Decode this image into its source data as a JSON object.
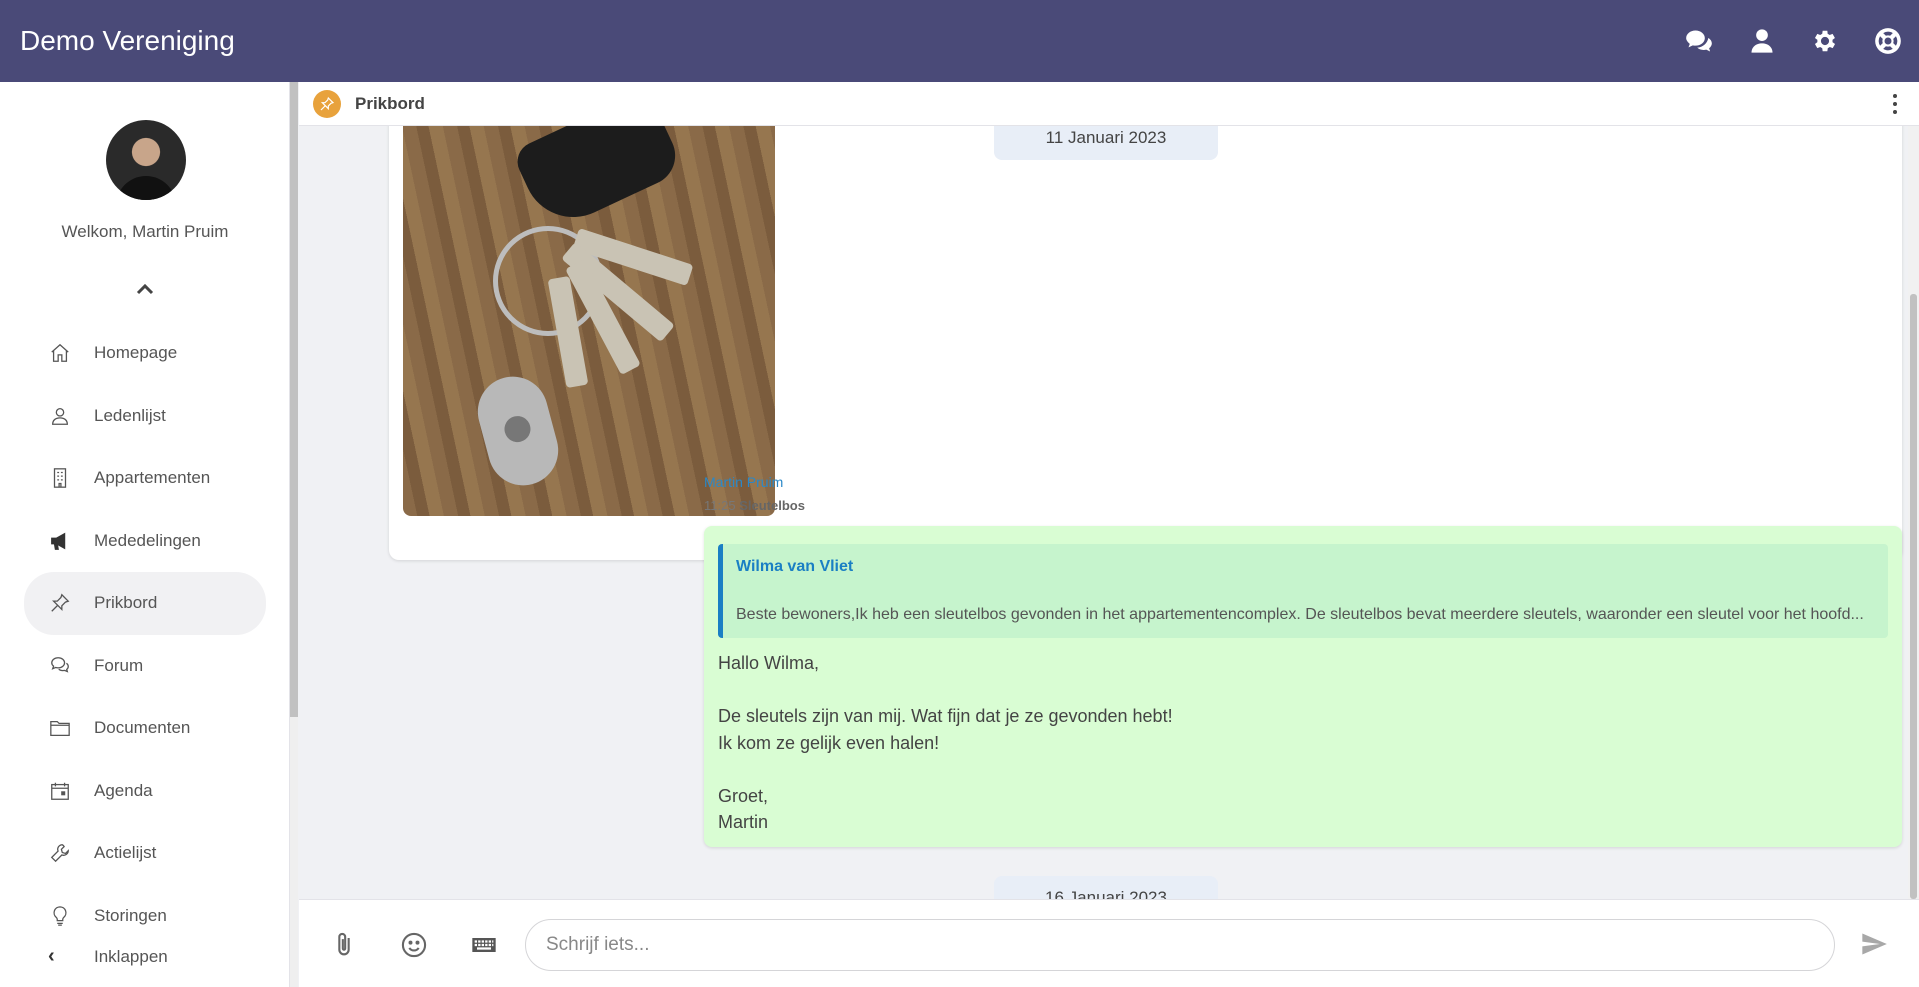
{
  "app": {
    "title": "Demo Vereniging"
  },
  "topbar_icons": [
    "chat-icon",
    "user-icon",
    "gear-icon",
    "lifebuoy-icon"
  ],
  "sidebar": {
    "welcome": "Welkom, Martin Pruim",
    "items": [
      {
        "label": "Homepage",
        "icon": "home-icon"
      },
      {
        "label": "Ledenlijst",
        "icon": "person-icon"
      },
      {
        "label": "Appartementen",
        "icon": "building-icon"
      },
      {
        "label": "Mededelingen",
        "icon": "megaphone-icon"
      },
      {
        "label": "Prikbord",
        "icon": "pin-icon",
        "active": true
      },
      {
        "label": "Forum",
        "icon": "chat-bubbles-icon"
      },
      {
        "label": "Documenten",
        "icon": "folder-icon"
      },
      {
        "label": "Agenda",
        "icon": "calendar-icon"
      },
      {
        "label": "Actielijst",
        "icon": "wrench-icon"
      },
      {
        "label": "Storingen",
        "icon": "lightbulb-icon"
      }
    ],
    "collapse_label": "Inklappen"
  },
  "chat": {
    "title": "Prikbord",
    "date_1": "11 Januari 2023",
    "date_2": "16 Januari 2023",
    "message": {
      "author": "Martin Pruim",
      "time": "11:25",
      "subject": "Sleutelbos",
      "quote_author": "Wilma van Vliet",
      "quote_text": "Beste bewoners,Ik heb een sleutelbos gevonden in het appartementencomplex. De sleutelbos bevat meerdere sleutels, waaronder een sleutel voor het hoofd...",
      "lines": [
        "Hallo Wilma,",
        "",
        "De sleutels zijn van mij. Wat fijn dat je ze gevonden hebt!",
        "Ik kom ze gelijk even halen!",
        "",
        "Groet,",
        "Martin"
      ]
    }
  },
  "composer": {
    "placeholder": "Schrijf iets...",
    "icons": [
      "paperclip-icon",
      "emoji-icon",
      "keyboard-icon",
      "send-icon"
    ]
  },
  "colors": {
    "topbar": "#4a4a78",
    "bubble": "#d9fdd3",
    "quote_accent": "#1a7fc4",
    "pin_badge": "#e8a23c"
  }
}
